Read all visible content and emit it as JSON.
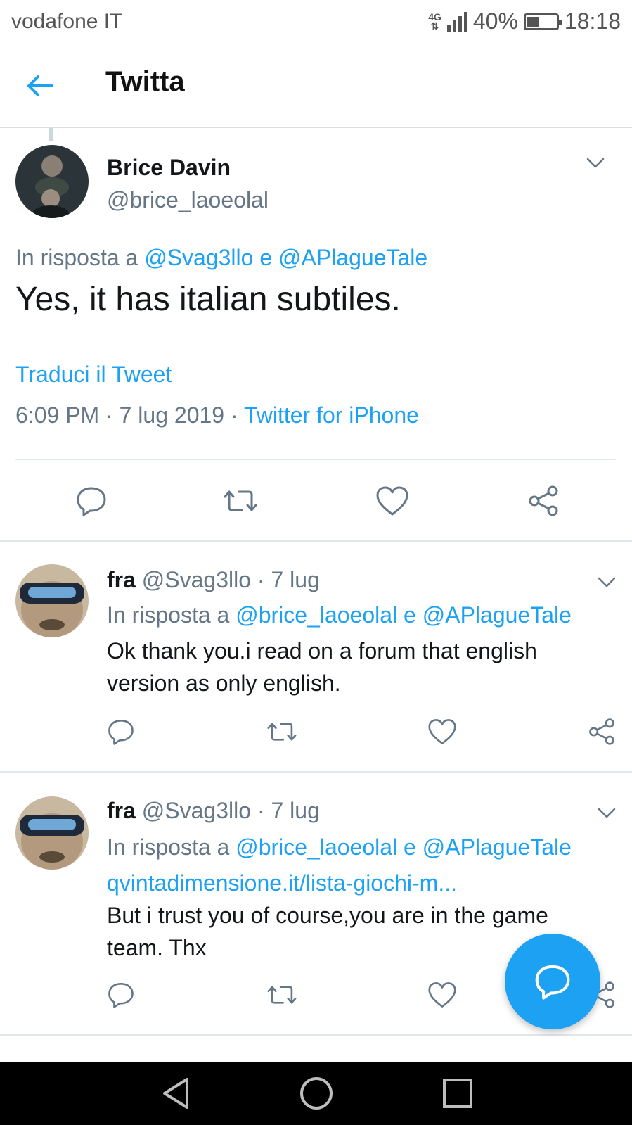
{
  "status_bar": {
    "carrier": "vodafone IT",
    "network_top": "4G",
    "network_bottom": "⇅",
    "battery_percent": "40%",
    "battery_level": 0.4,
    "time": "18:18"
  },
  "header": {
    "title": "Twitta",
    "back_icon": "arrow-left-icon"
  },
  "main_tweet": {
    "name": "Brice Davin",
    "handle": "@brice_laoeolal",
    "reply_prefix": "In risposta a ",
    "reply_user1": "@Svag3llo",
    "reply_and": " e ",
    "reply_user2": "@APlagueTale",
    "text": "Yes, it has italian subtiles.",
    "translate": "Traduci il Tweet",
    "meta_time": "6:09 PM · 7 lug 2019 · ",
    "meta_source": "Twitter for iPhone"
  },
  "replies": [
    {
      "name": "fra",
      "handle": "@Svag3llo",
      "date": "· 7 lug",
      "reply_prefix": "In risposta a ",
      "reply_user1": "@brice_laoeolal",
      "reply_and": " e ",
      "reply_user2": "@APlagueTale",
      "text": "Ok thank you.i read on a forum that english version as only english."
    },
    {
      "name": "fra",
      "handle": "@Svag3llo",
      "date": "· 7 lug",
      "reply_prefix": "In risposta a ",
      "reply_user1": "@brice_laoeolal",
      "reply_and": " e ",
      "reply_user2": "@APlagueTale",
      "link": "qvintadimensione.it/lista-giochi-m...",
      "text": "But i trust you of course,you are in the game team. Thx"
    }
  ],
  "actions": [
    "reply-icon",
    "retweet-icon",
    "like-icon",
    "share-icon"
  ],
  "fab_icon": "compose-reply-icon",
  "nav": [
    "back-triangle-icon",
    "home-circle-icon",
    "recents-square-icon"
  ],
  "colors": {
    "accent": "#1da1f2",
    "text": "#14171a",
    "secondary": "#657786",
    "divider": "#e1e8ed"
  }
}
